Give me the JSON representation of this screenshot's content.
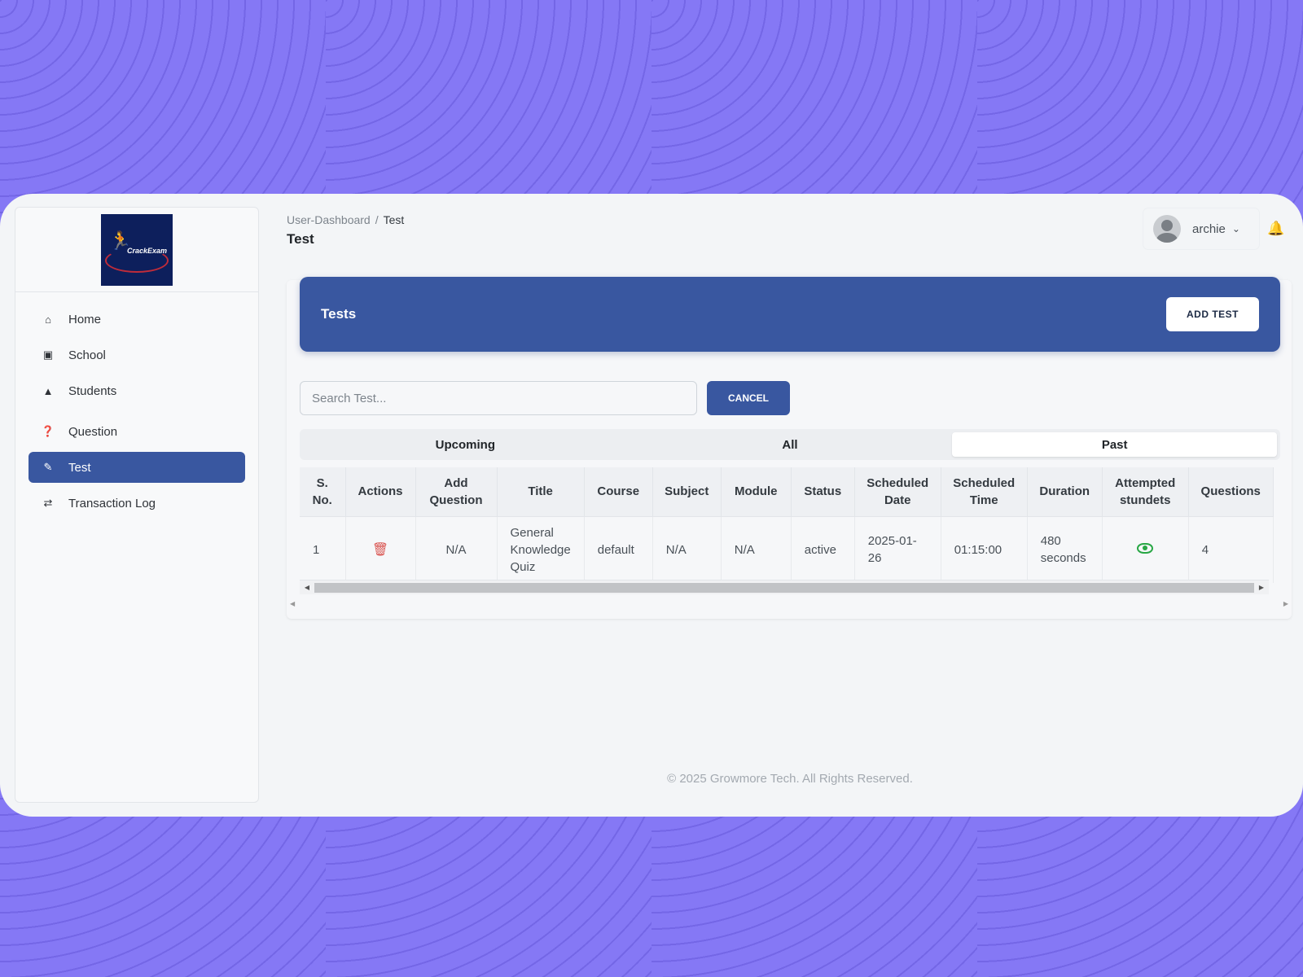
{
  "sidebar": {
    "logo_text": "CrackExam",
    "items": [
      {
        "label": "Home",
        "icon": "home-icon"
      },
      {
        "label": "School",
        "icon": "school-icon"
      },
      {
        "label": "Students",
        "icon": "graduation-cap-icon"
      },
      {
        "label": "Question",
        "icon": "question-circle-icon"
      },
      {
        "label": "Test",
        "icon": "pencil-icon",
        "active": true
      },
      {
        "label": "Transaction Log",
        "icon": "exchange-icon"
      }
    ]
  },
  "header": {
    "breadcrumb": [
      "User-Dashboard",
      "Test"
    ],
    "breadcrumb_sep": "/",
    "title": "Test",
    "user_name": "archie"
  },
  "card": {
    "title": "Tests",
    "add_button": "ADD TEST",
    "search_placeholder": "Search Test...",
    "cancel_button": "CANCEL",
    "tabs": [
      {
        "label": "Upcoming"
      },
      {
        "label": "All"
      },
      {
        "label": "Past",
        "active": true
      }
    ]
  },
  "table": {
    "columns": [
      [
        "S.",
        "No."
      ],
      [
        "Actions"
      ],
      [
        "Add",
        "Question"
      ],
      [
        "Title"
      ],
      [
        "Course"
      ],
      [
        "Subject"
      ],
      [
        "Module"
      ],
      [
        "Status"
      ],
      [
        "Scheduled",
        "Date"
      ],
      [
        "Scheduled",
        "Time"
      ],
      [
        "Duration"
      ],
      [
        "Attempted",
        "stundets"
      ],
      [
        "Questions"
      ]
    ],
    "rows": [
      {
        "sno": "1",
        "add_question": "N/A",
        "title": [
          "General",
          "Knowledge",
          "Quiz"
        ],
        "course": "default",
        "subject": "N/A",
        "module": "N/A",
        "status": "active",
        "scheduled_date": [
          "2025-01-",
          "26"
        ],
        "scheduled_time": "01:15:00",
        "duration": [
          "480",
          "seconds"
        ],
        "questions": "4"
      }
    ]
  },
  "footer": "© 2025 Growmore Tech. All Rights Reserved.",
  "colors": {
    "accent": "#3957a0",
    "delete": "#d9534f",
    "view": "#28a745"
  }
}
